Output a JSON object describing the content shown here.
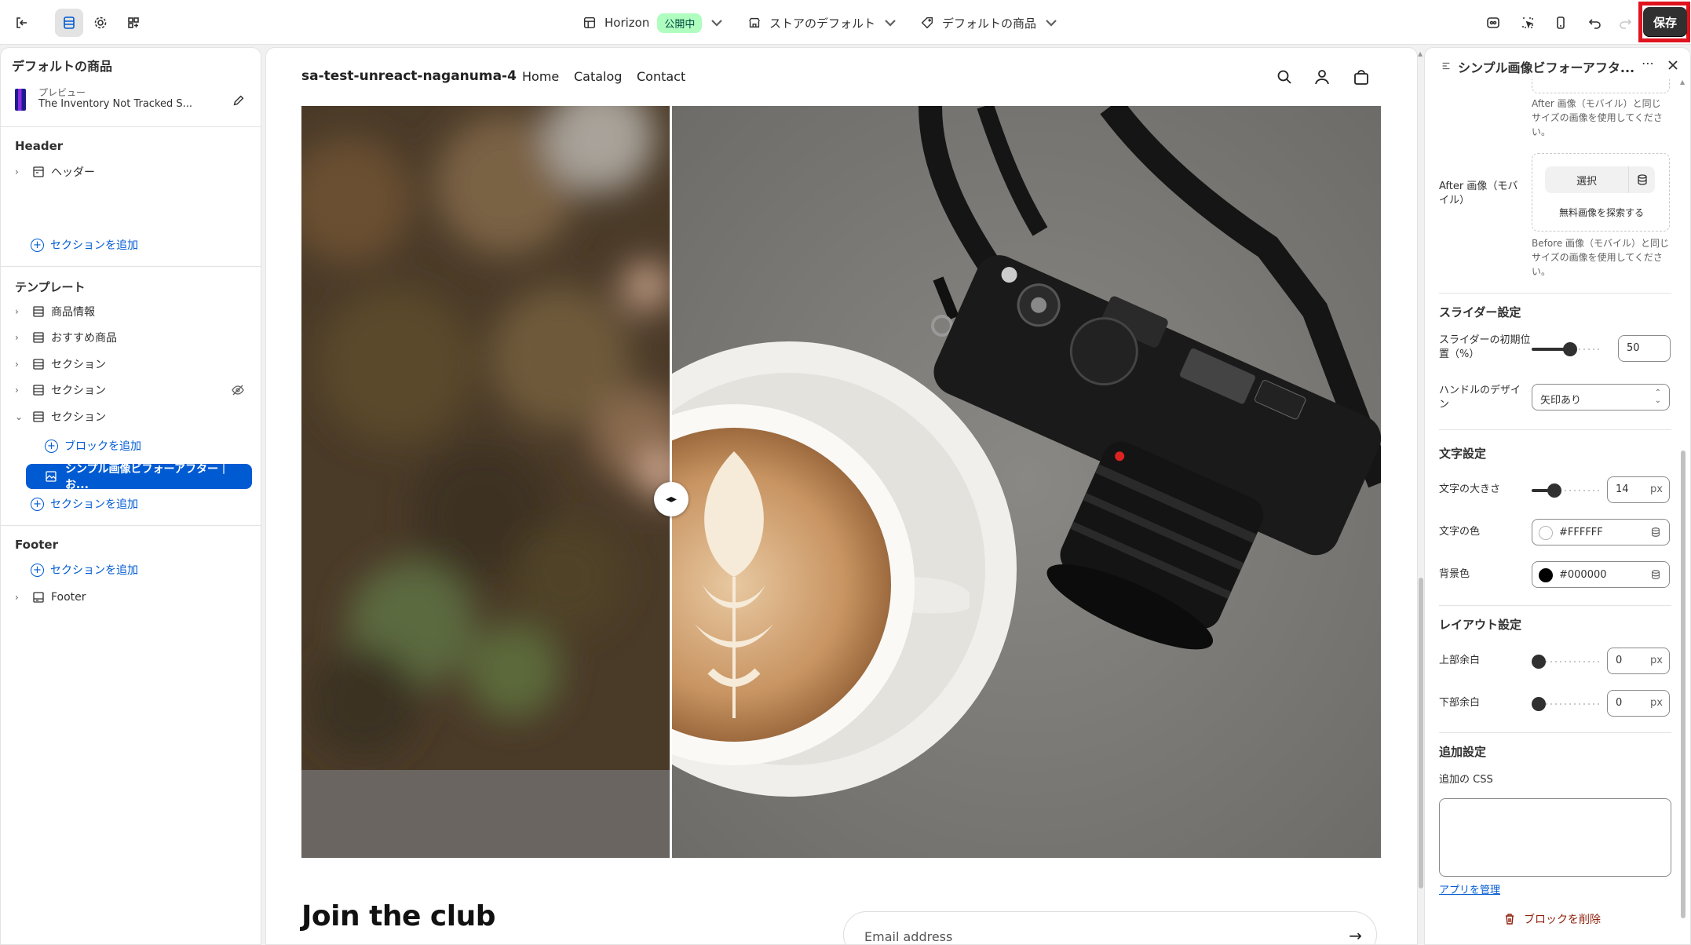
{
  "topbar": {
    "theme_name": "Horizon",
    "theme_badge": "公開中",
    "store_default": "ストアのデフォルト",
    "product_default": "デフォルトの商品",
    "save_label": "保存"
  },
  "left": {
    "title": "デフォルトの商品",
    "preview_label": "プレビュー",
    "preview_product": "The Inventory Not Tracked S...",
    "header_heading": "Header",
    "header_item": "ヘッダー",
    "add_section": "セクションを追加",
    "template_heading": "テンプレート",
    "template_items": [
      "商品情報",
      "おすすめ商品",
      "セクション",
      "セクション",
      "セクション"
    ],
    "add_block": "ブロックを追加",
    "selected_block": "シンプル画像ビフォーアフター｜お...",
    "footer_heading": "Footer",
    "footer_item": "Footer"
  },
  "preview": {
    "store_name": "sa-test-unreact-naganuma-4",
    "nav": [
      "Home",
      "Catalog",
      "Contact"
    ],
    "join_title": "Join the club",
    "email_placeholder": "Email address"
  },
  "right": {
    "title": "シンプル画像ビフォーアフタ...",
    "after_help_top": "After 画像（モバイル）と同じサイズの画像を使用してください。",
    "after_mobile_label": "After 画像（モバイル）",
    "select_label": "選択",
    "explore_free": "無料画像を探索する",
    "before_help": "Before 画像（モバイル）と同じサイズの画像を使用してください。",
    "slider_heading": "スライダー設定",
    "slider_pos_label": "スライダーの初期位置（%）",
    "slider_pos_value": "50",
    "handle_design_label": "ハンドルのデザイン",
    "handle_design_value": "矢印あり",
    "text_heading": "文字設定",
    "text_size_label": "文字の大きさ",
    "text_size_value": "14",
    "px": "px",
    "text_color_label": "文字の色",
    "text_color_value": "#FFFFFF",
    "bg_color_label": "背景色",
    "bg_color_value": "#000000",
    "layout_heading": "レイアウト設定",
    "top_margin_label": "上部余白",
    "top_margin_value": "0",
    "bottom_margin_label": "下部余白",
    "bottom_margin_value": "0",
    "extra_heading": "追加設定",
    "css_label": "追加の CSS",
    "manage_apps": "アプリを管理",
    "delete_block": "ブロックを削除"
  },
  "colors": {
    "accent": "#005bd3",
    "save_bg": "#303030",
    "highlight": "#e0141e"
  }
}
